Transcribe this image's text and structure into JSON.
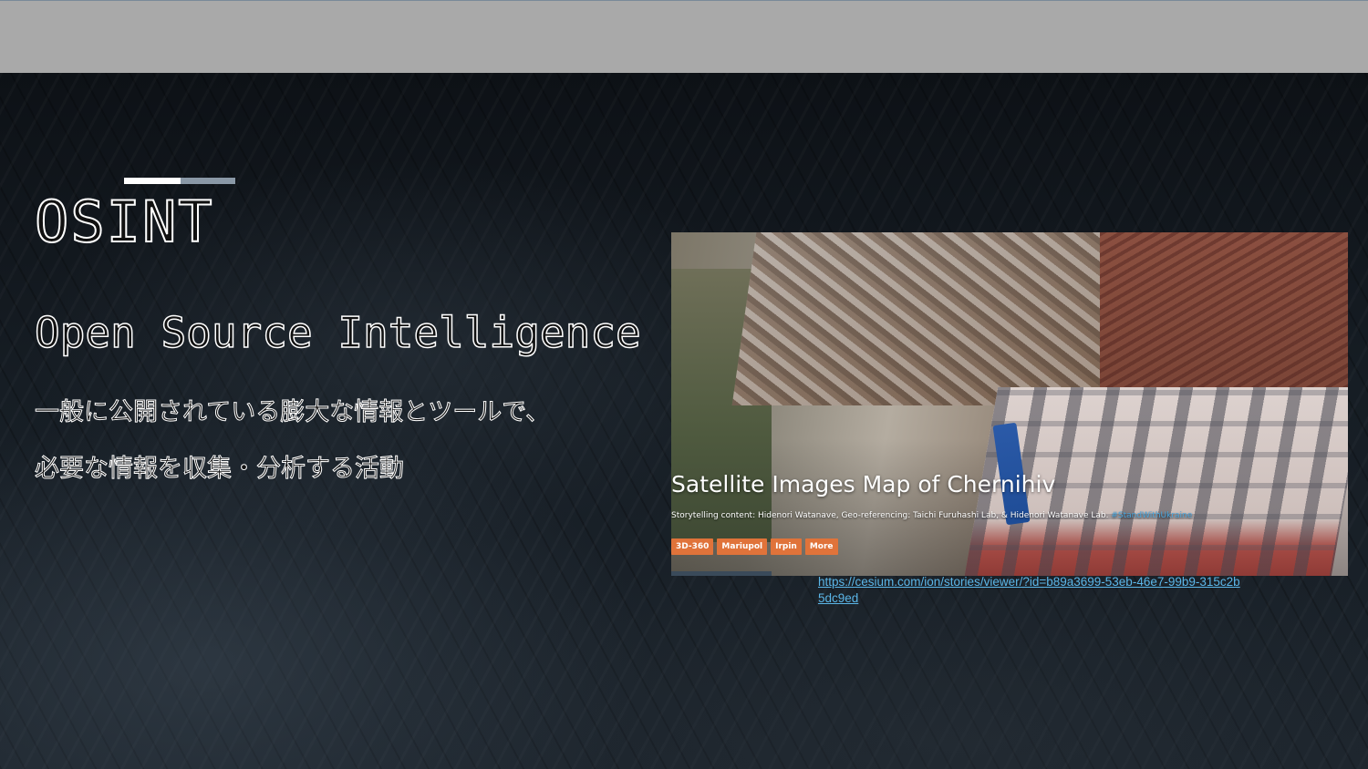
{
  "slide": {
    "title": "OSINT",
    "subtitle": "Open Source Intelligence",
    "description_lines": [
      "一般に公開されている膨大な情報とツールで、",
      "必要な情報を収集・分析する活動"
    ]
  },
  "screenshot": {
    "heading": "Satellite Images Map of Chernihiv",
    "credits": "Storytelling content: Hidenori Watanave, Geo-referencing: Taichi Furuhashi Lab, & Hidenori Watanave Lab.",
    "credits_link": "#StandWithUkraine",
    "tags": [
      "3D-360",
      "Mariupol",
      "Irpin",
      "More"
    ]
  },
  "link": {
    "url": "https://cesium.com/ion/stories/viewer/?id=b89a3699-53eb-46e7-99b9-315c2b5dc9ed"
  },
  "colors": {
    "topbar": "#a9a9a9",
    "accent_bar": "#ffffff",
    "accent_bar_secondary": "#8a98a6",
    "tag": "#e0733a",
    "link": "#5bb6e8"
  }
}
